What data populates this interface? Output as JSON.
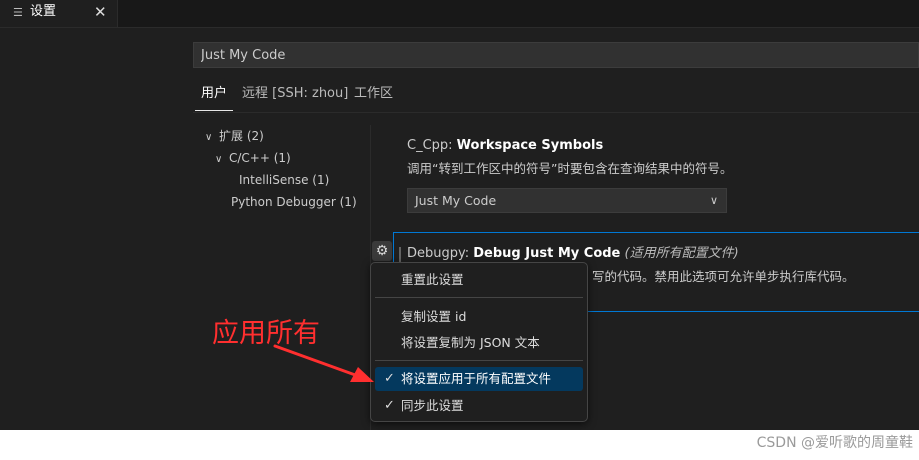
{
  "tab": {
    "icon": "list-lines-icon",
    "title": "设置",
    "close": "✕"
  },
  "search": {
    "value": "Just My Code"
  },
  "scope_tabs": [
    {
      "label": "用户"
    },
    {
      "label": "远程 [SSH: zhou]"
    },
    {
      "label": "工作区"
    }
  ],
  "toc": [
    {
      "label": "扩展 (2)"
    },
    {
      "label": "C/C++ (1)"
    },
    {
      "label": "IntelliSense (1)"
    },
    {
      "label": "Python Debugger (1)"
    }
  ],
  "setting1": {
    "prefix": "C_Cpp: ",
    "name": "Workspace Symbols",
    "description": "调用“转到工作区中的符号”时要包含在查询结果中的符号。",
    "value": "Just My Code"
  },
  "setting2": {
    "prefix": "Debugpy: ",
    "name": "Debug Just My Code",
    "scope_note": "(适用所有配置文件)",
    "description": "写的代码。禁用此选项可允许单步执行库代码。"
  },
  "context_menu": {
    "items": [
      {
        "label": "重置此设置",
        "checked": ""
      },
      {
        "label": "复制设置 id",
        "checked": ""
      },
      {
        "label": "将设置复制为 JSON 文本",
        "checked": ""
      },
      {
        "label": "将设置应用于所有配置文件",
        "checked": "✓"
      },
      {
        "label": "同步此设置",
        "checked": "✓"
      }
    ]
  },
  "annotation": {
    "text": "应用所有",
    "color": "#ff2f2f"
  },
  "watermark": "CSDN @爱听歌的周童鞋",
  "colors": {
    "accent": "#0078d4",
    "highlight": "#04395e",
    "background": "#1f1f1f"
  }
}
